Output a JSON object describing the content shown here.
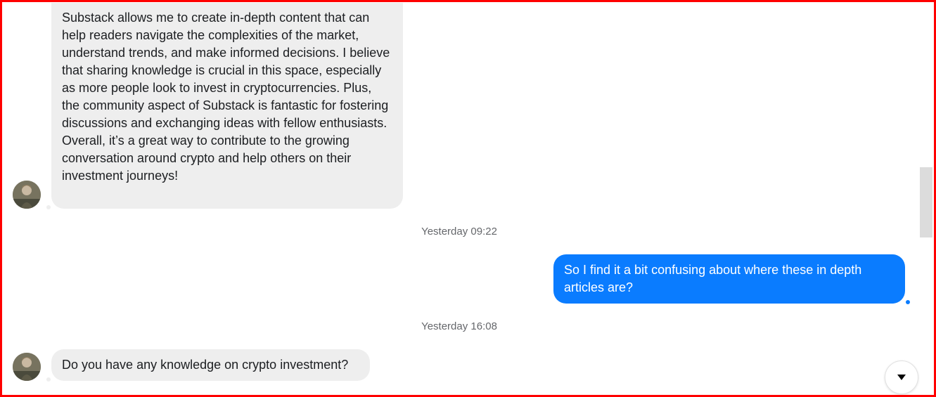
{
  "messages": {
    "first_incoming": "Substack allows me to create in-depth content that can help readers navigate the complexities of the market, understand trends, and make informed decisions. I believe that sharing knowledge is crucial in this space, especially as more people look to invest in cryptocurrencies. Plus, the community aspect of Substack is fantastic for fostering discussions and exchanging ideas with fellow enthusiasts. Overall, it’s a great way to contribute to the growing conversation around crypto and help others on their investment journeys!",
    "timestamp_1": "Yesterday 09:22",
    "outgoing": "So I find it a bit confusing about where these in depth articles are?",
    "timestamp_2": "Yesterday 16:08",
    "second_incoming": "Do you have any knowledge on crypto investment?"
  },
  "colors": {
    "incoming_bubble": "#eeeeee",
    "outgoing_bubble": "#0a7cff",
    "frame_border": "#ff0000"
  },
  "icons": {
    "scroll_down": "caret-down-icon"
  }
}
